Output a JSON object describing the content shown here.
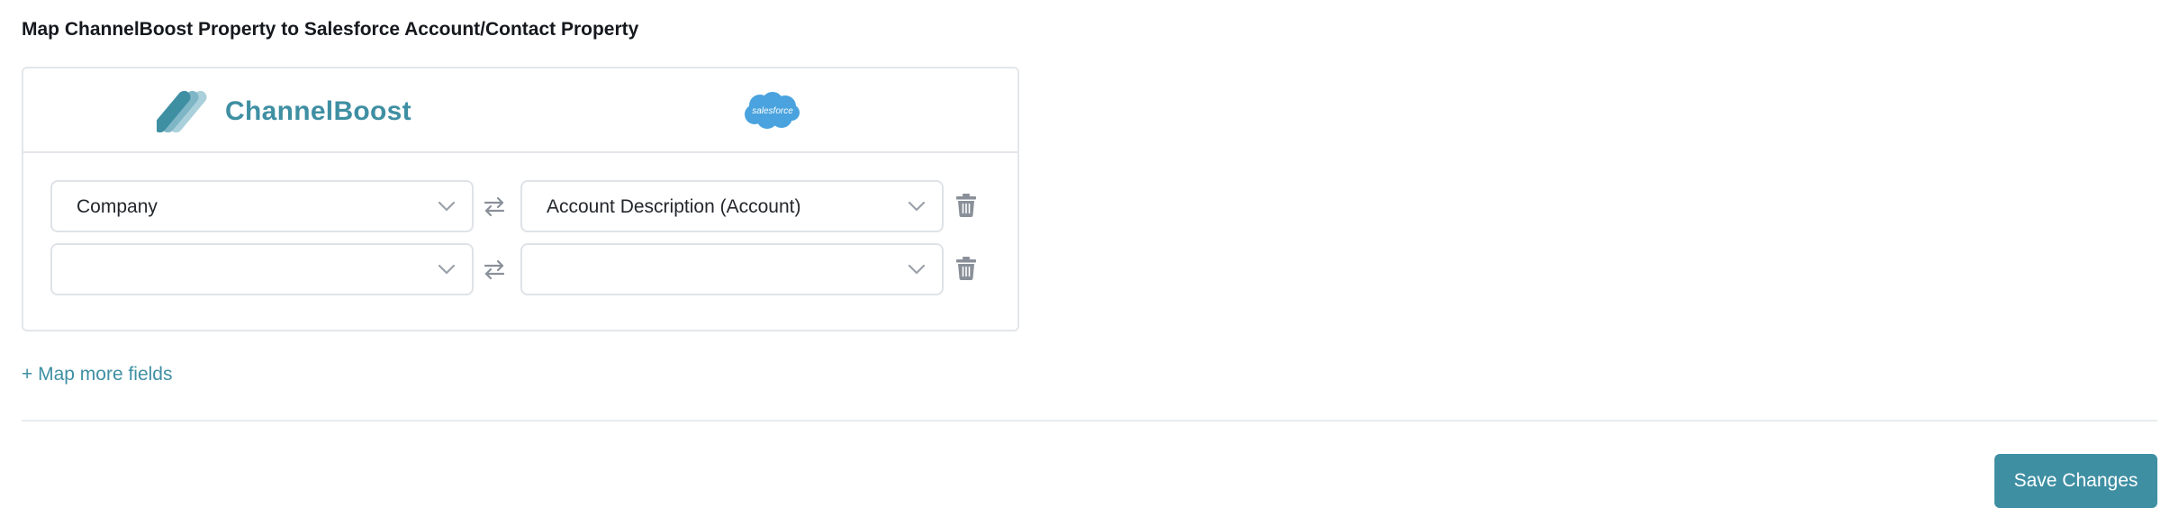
{
  "section": {
    "title": "Map ChannelBoost Property to Salesforce Account/Contact Property"
  },
  "header": {
    "channelboost_logo_text": "ChannelBoost",
    "salesforce_logo_text": "salesforce"
  },
  "mappings": [
    {
      "channelboost_field": "Company",
      "salesforce_field": "Account Description (Account)"
    },
    {
      "channelboost_field": "",
      "salesforce_field": ""
    }
  ],
  "actions": {
    "map_more_label": "+ Map more fields",
    "save_label": "Save Changes"
  },
  "colors": {
    "accent": "#3f8fa3",
    "salesforce_blue": "#4aa3de",
    "icon_gray": "#8a9099",
    "border": "#e3e6ea"
  },
  "icons": {
    "swap": "swap-arrows-icon",
    "delete": "trash-icon",
    "dropdown": "chevron-down-icon"
  }
}
